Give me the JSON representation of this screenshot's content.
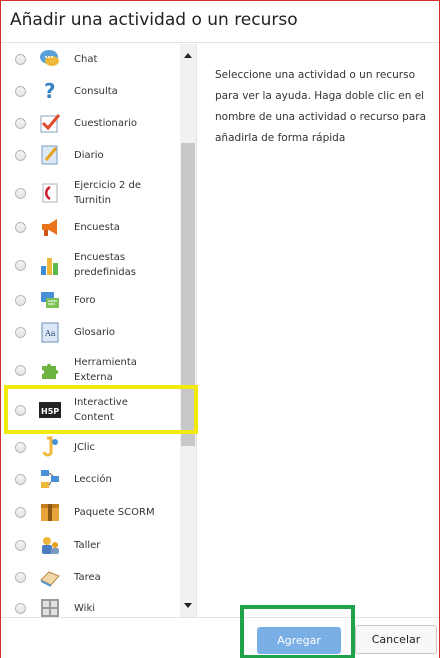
{
  "dialog": {
    "title": "Añadir una actividad o un recurso"
  },
  "activities": [
    {
      "label": "Chat",
      "icon": "chat-icon"
    },
    {
      "label": "Consulta",
      "icon": "question-icon"
    },
    {
      "label": "Cuestionario",
      "icon": "quiz-icon"
    },
    {
      "label": "Diario",
      "icon": "journal-icon"
    },
    {
      "label": "Ejercicio 2 de Turnitin",
      "icon": "turnitin-icon"
    },
    {
      "label": "Encuesta",
      "icon": "megaphone-icon"
    },
    {
      "label": "Encuestas predefinidas",
      "icon": "bar-chart-icon"
    },
    {
      "label": "Foro",
      "icon": "forum-icon"
    },
    {
      "label": "Glosario",
      "icon": "glossary-icon"
    },
    {
      "label": "Herramienta Externa",
      "icon": "puzzle-icon"
    },
    {
      "label": "Interactive Content",
      "icon": "h5p-icon"
    },
    {
      "label": "JClic",
      "icon": "jclic-icon"
    },
    {
      "label": "Lección",
      "icon": "lesson-icon"
    },
    {
      "label": "Paquete SCORM",
      "icon": "scorm-package-icon"
    },
    {
      "label": "Taller",
      "icon": "workshop-icon"
    },
    {
      "label": "Tarea",
      "icon": "assignment-icon"
    },
    {
      "label": "Wiki",
      "icon": "wiki-icon"
    }
  ],
  "help": {
    "text": "Seleccione una actividad o un recurso para ver la ayuda. Haga doble clic en el nombre de una actividad o recurso para añadirla de forma rápida"
  },
  "footer": {
    "add_label": "Agregar",
    "cancel_label": "Cancelar"
  },
  "colors": {
    "dialog_border": "#d32f2f",
    "add_button": "#7aafe5",
    "highlight_item": "#f2ea0c",
    "highlight_button": "#1fa34a"
  }
}
